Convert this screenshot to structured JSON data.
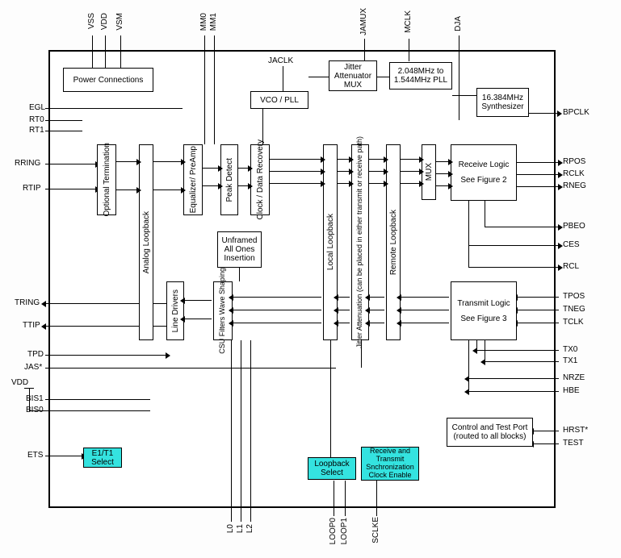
{
  "blocks": {
    "power_connections": "Power Connections",
    "vco_pll": "VCO / PLL",
    "jitter_mux": "Jitter Attenuator MUX",
    "pll_2048": "2.048MHz to 1.544MHz PLL",
    "synth_16384": "16.384MHz Synthesizer",
    "optional_term": "Optional Termination",
    "analog_loopback": "Analog Loopback",
    "eq_preamp": "Equalizer/ PreAmp",
    "peak_detect": "Peak Detect",
    "clock_data_rec": "Clock / Data Recovery",
    "local_loopback": "Local Loopback",
    "jitter_atten": "Jitter Attenuation (can be placed in either transmit or receive path)",
    "remote_loopback": "Remote Loopback",
    "mux": "MUX",
    "receive_logic": "Receive Logic",
    "see_fig2": "See Figure 2",
    "unframed_ones": "Unframed All Ones Insertion",
    "line_drivers": "Line Drivers",
    "csu_wave": "CSU Filters Wave Shaping",
    "transmit_logic": "Transmit Logic",
    "see_fig3": "See Figure 3",
    "control_test_port": "Control and Test Port (routed to all blocks)",
    "e1t1_select": "E1/T1 Select",
    "loopback_select": "Loopback Select",
    "rx_tx_sync_clock": "Receive and Transmit Snchronization Clock Enable"
  },
  "labels": {
    "jaclk": "JACLK"
  },
  "pins": {
    "top": {
      "vss": "VSS",
      "vdd_top": "VDD",
      "vsm": "VSM",
      "mm0": "MM0",
      "mm1": "MM1",
      "jamux": "JAMUX",
      "mclk": "MCLK",
      "dja": "DJA"
    },
    "left": {
      "egl": "EGL",
      "rt0": "RT0",
      "rt1": "RT1",
      "rring": "RRING",
      "rtip": "RTIP",
      "tring": "TRING",
      "ttip": "TTIP",
      "tpd": "TPD",
      "jas": "JAS*",
      "vdd_left": "VDD",
      "bis1": "BIS1",
      "bis0": "BIS0",
      "ets": "ETS"
    },
    "right": {
      "bpclk": "BPCLK",
      "rpos": "RPOS",
      "rclk": "RCLK",
      "rneg": "RNEG",
      "pbeo": "PBEO",
      "ces": "CES",
      "rcl": "RCL",
      "tpos": "TPOS",
      "tneg": "TNEG",
      "tclk": "TCLK",
      "tx0": "TX0",
      "tx1": "TX1",
      "nrze": "NRZE",
      "hbe": "HBE",
      "hrst": "HRST*",
      "test": "TEST"
    },
    "bottom": {
      "l0": "L0",
      "l1": "L1",
      "l2": "L2",
      "loop0": "LOOP0",
      "loop1": "LOOP1",
      "sclke": "SCLKE"
    }
  }
}
